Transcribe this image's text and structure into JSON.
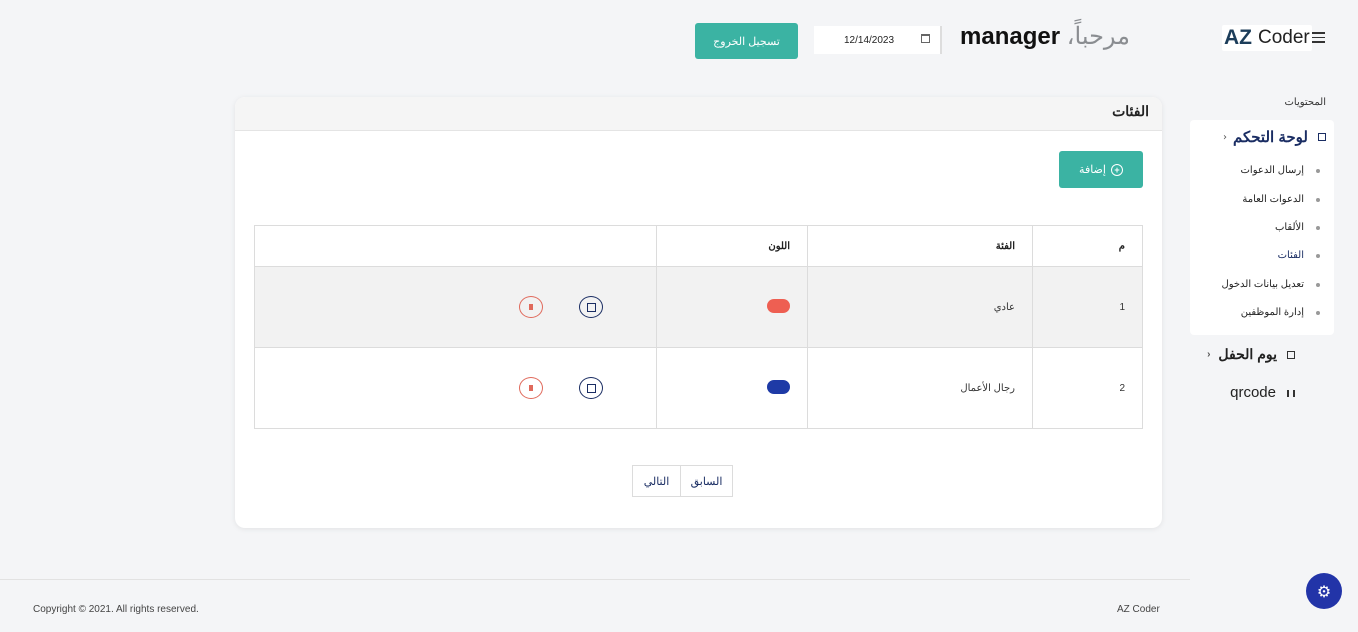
{
  "header": {
    "brand_az": "AZ",
    "brand_coder": "Coder",
    "welcome_prefix": "مرحباً،",
    "welcome_user": "manager",
    "date_value": "12/14/2023",
    "logout_label": "تسجيل الخروج"
  },
  "sidebar": {
    "heading": "المحتويات",
    "dashboard": {
      "label": "لوحة التحكم",
      "icon": "grid-icon"
    },
    "items": [
      {
        "label": "إرسال الدعوات"
      },
      {
        "label": "الدعوات العامة"
      },
      {
        "label": "الألقاب"
      },
      {
        "label": "الفئات",
        "active": true
      },
      {
        "label": "تعديل بيانات الدخول"
      },
      {
        "label": "إدارة الموظفين"
      }
    ],
    "party_day": {
      "label": "يوم الحفل",
      "icon": "calendar-icon"
    },
    "qrcode": {
      "label": "qrcode",
      "icon": "barcode-icon"
    }
  },
  "main": {
    "title": "الفئات",
    "add_label": "إضافة",
    "table": {
      "headers": [
        "م",
        "الفئة",
        "اللون",
        ""
      ],
      "rows": [
        {
          "num": "1",
          "name": "عادي",
          "color": "#ee5f52"
        },
        {
          "num": "2",
          "name": "رجال الأعمال",
          "color": "#1e3aa6"
        }
      ]
    },
    "pager": {
      "prev": "السابق",
      "next": "التالي"
    }
  },
  "footer": {
    "copyright": "Copyright © 2021. All rights reserved.",
    "brand": "AZ Coder"
  },
  "colors": {
    "accent": "#3bb3a3",
    "navy": "#1a2d63",
    "gear_bg": "#2234a8"
  }
}
